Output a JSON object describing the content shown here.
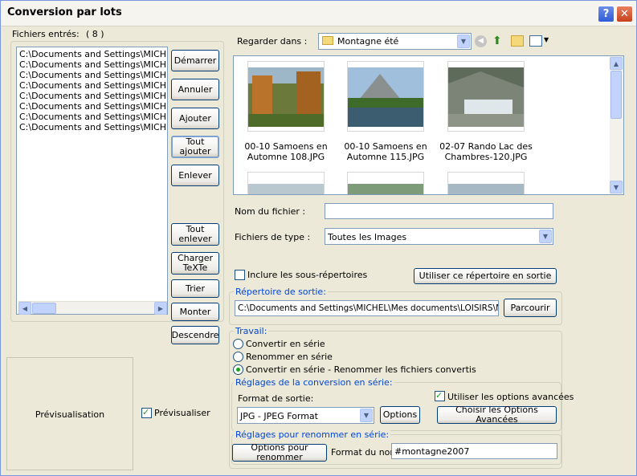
{
  "window": {
    "title": "Conversion par lots"
  },
  "files": {
    "label": "Fichiers entrés:",
    "count": "( 8 )",
    "items": [
      "C:\\Documents and Settings\\MICHEL\\",
      "C:\\Documents and Settings\\MICHEL\\",
      "C:\\Documents and Settings\\MICHEL\\",
      "C:\\Documents and Settings\\MICHEL\\",
      "C:\\Documents and Settings\\MICHEL\\",
      "C:\\Documents and Settings\\MICHEL\\",
      "C:\\Documents and Settings\\MICHEL\\",
      "C:\\Documents and Settings\\MICHEL\\"
    ]
  },
  "buttons": {
    "demarrer": "Démarrer",
    "annuler": "Annuler",
    "ajouter": "Ajouter",
    "tout_ajouter": "Tout ajouter",
    "enlever": "Enlever",
    "tout_enlever": "Tout enlever",
    "charger_texte": "Charger TeXTe",
    "trier": "Trier",
    "monter": "Monter",
    "descendre": "Descendre"
  },
  "browser": {
    "look_in_label": "Regarder dans :",
    "folder": "Montagne été",
    "thumbs": [
      {
        "line1": "00-10 Samoens en",
        "line2": "Automne 108.JPG"
      },
      {
        "line1": "00-10 Samoens en",
        "line2": "Automne 115.JPG"
      },
      {
        "line1": "02-07 Rando Lac des",
        "line2": "Chambres-120.JPG"
      }
    ]
  },
  "filename": {
    "label": "Nom du fichier :",
    "value": ""
  },
  "filetype": {
    "label": "Fichiers de type :",
    "value": "Toutes les Images"
  },
  "include_sub": {
    "label": "Inclure les sous-répertoires"
  },
  "use_dir_button": "Utiliser ce répertoire en sortie",
  "output_dir": {
    "label": "Répertoire de sortie:",
    "value": "C:\\Documents and Settings\\MICHEL\\Mes documents\\LOISIRS\\MI",
    "browse": "Parcourir"
  },
  "travail": {
    "label": "Travail:",
    "options": [
      "Convertir en série",
      "Renommer en série",
      "Convertir en série - Renommer les fichiers convertis"
    ]
  },
  "conversion": {
    "label": "Réglages de la conversion en série:",
    "format_label": "Format de sortie:",
    "format_value": "JPG - JPEG Format",
    "options_button": "Options",
    "advanced_label": "Utiliser les options avancées",
    "advanced_button": "Choisir les Options Avancées"
  },
  "rename": {
    "label": "Réglages pour renommer en série:",
    "options_button": "Options pour renommer",
    "name_format_label": "Format du nom:",
    "name_format_value": "#montagne2007"
  },
  "preview": {
    "box_label": "Prévisualisation",
    "check_label": "Prévisualiser"
  }
}
